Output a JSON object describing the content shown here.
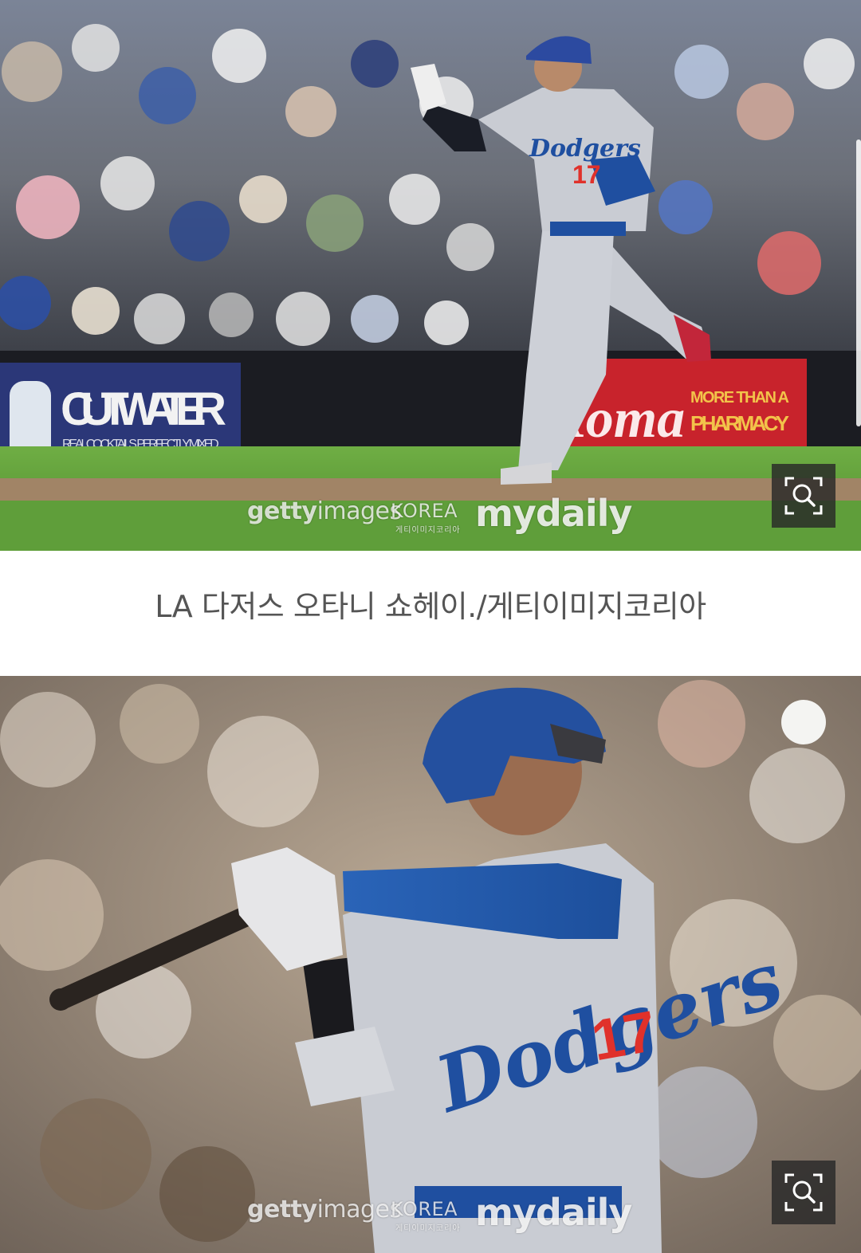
{
  "photos": [
    {
      "watermark": {
        "getty_bold": "getty",
        "getty_light": "images",
        "korea": "KOREA",
        "sub": "게티이미지코리아",
        "mydaily": "mydaily"
      },
      "signs": {
        "sponsor_left": "CUTWATER",
        "sponsor_left_sub": "REAL COCKTAILS. PERFECTLY MIXED.",
        "sponsor_right": "Roma",
        "sponsor_right_tag": "MORE THAN A PHARMACY"
      },
      "jersey": {
        "team": "Dodgers",
        "number": "17"
      },
      "zoom_icon": "zoom-search-icon"
    },
    {
      "watermark": {
        "getty_bold": "getty",
        "getty_light": "images",
        "korea": "KOREA",
        "sub": "게티이미지코리아",
        "mydaily": "mydaily"
      },
      "jersey": {
        "team": "Dodgers",
        "number": "17"
      },
      "zoom_icon": "zoom-search-icon"
    }
  ],
  "caption": "LA 다저스 오타니 쇼헤이./게티이미지코리아",
  "colors": {
    "dodger_blue": "#1f4fa0",
    "jersey_gray": "#c9ccd3",
    "jersey_red": "#e0312b",
    "grass": "#5f9e3a",
    "caption_text": "#555555"
  }
}
